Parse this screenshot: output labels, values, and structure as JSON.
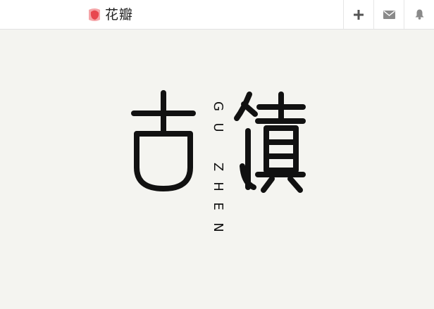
{
  "header": {
    "brand_name": "花瓣",
    "brand_logo_icon": "huaban-petal-icon",
    "accent_color": "#e8474f",
    "actions": [
      {
        "id": "add",
        "icon": "plus-icon"
      },
      {
        "id": "messages",
        "icon": "mail-icon"
      },
      {
        "id": "notifications",
        "icon": "bell-icon"
      }
    ]
  },
  "artwork": {
    "latin_letters": [
      "G",
      "U",
      "Z",
      "H",
      "E",
      "N"
    ]
  }
}
